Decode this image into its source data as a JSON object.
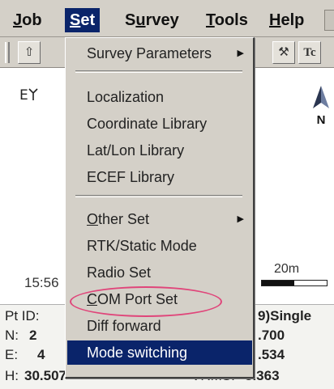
{
  "menubar": {
    "items": [
      {
        "mnemonic": "J",
        "rest": "ob"
      },
      {
        "mnemonic": "S",
        "rest": "et"
      },
      {
        "pre": "S",
        "mnemonic": "u",
        "rest": "rvey"
      },
      {
        "mnemonic": "T",
        "rest": "ools"
      },
      {
        "mnemonic": "H",
        "rest": "elp"
      }
    ]
  },
  "toolbar": {
    "buttons": [
      "up-icon",
      "route-icon",
      "tc-icon"
    ],
    "glyphs": [
      "⇧",
      "⚒",
      "Tc"
    ]
  },
  "map": {
    "corner_label": "E",
    "corner_icon": "antenna-icon",
    "north_label": "N",
    "time": "15:56",
    "scale_label": "20m"
  },
  "status": {
    "pt_id_label": "Pt ID:",
    "solution": "9)Single",
    "n_label": "N:",
    "n_value_partial": "2",
    "n_tail": ".700",
    "e_label": "E:",
    "e_value_partial": "4",
    "e_tail": ".534",
    "h_label": "H:",
    "h_value": "30.507",
    "vrms_label": "VRMS:",
    "vrms_value": "3.363"
  },
  "set_menu": {
    "items": [
      {
        "label": "Survey Parameters",
        "submenu": true
      },
      {
        "label": "Localization"
      },
      {
        "label": "Coordinate Library"
      },
      {
        "label": "Lat/Lon Library"
      },
      {
        "label": "ECEF Library"
      },
      {
        "mnemonic": "O",
        "rest": "ther Set",
        "submenu": true
      },
      {
        "label": "RTK/Static Mode"
      },
      {
        "label": "Radio Set"
      },
      {
        "mnemonic": "C",
        "rest": "OM Port Set"
      },
      {
        "label": "Diff forward"
      },
      {
        "label": "Mode switching"
      }
    ],
    "highlighted_index": 10,
    "circled_index": 8,
    "circle_color": "#e0457a",
    "highlight_color": "#0a246a"
  }
}
